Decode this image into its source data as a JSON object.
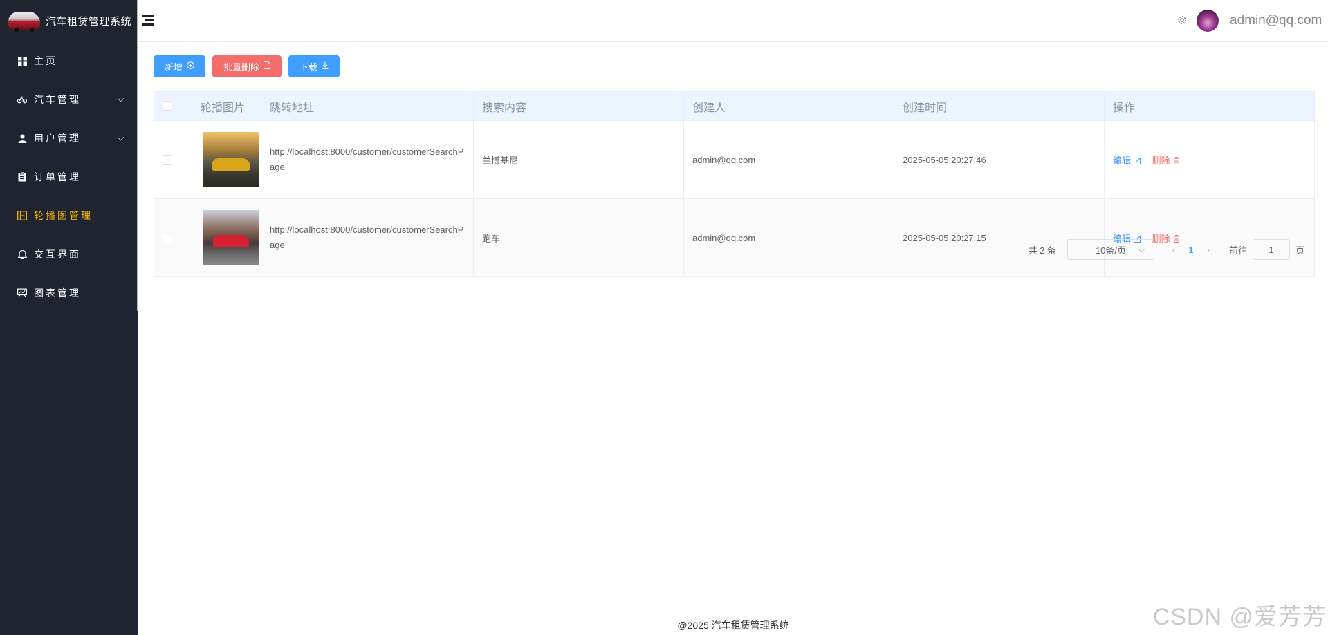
{
  "sidebar": {
    "app_title": "汽车租赁管理系统",
    "items": [
      {
        "label": "主页",
        "icon": "grid-icon"
      },
      {
        "label": "汽车管理",
        "icon": "bicycle-icon",
        "has_arrow": true
      },
      {
        "label": "用户管理",
        "icon": "user-icon",
        "has_arrow": true
      },
      {
        "label": "订单管理",
        "icon": "clipboard-icon"
      },
      {
        "label": "轮播图管理",
        "icon": "carousel-icon",
        "active": true
      },
      {
        "label": "交互界面",
        "icon": "bell-icon"
      },
      {
        "label": "图表管理",
        "icon": "chart-board-icon"
      }
    ]
  },
  "header": {
    "user": "admin@qq.com"
  },
  "toolbar": {
    "add_label": "新增",
    "batch_delete_label": "批量删除",
    "download_label": "下载"
  },
  "table": {
    "columns": [
      "轮播图片",
      "跳转地址",
      "搜索内容",
      "创建人",
      "创建时间",
      "操作"
    ],
    "rows": [
      {
        "url": "http://localhost:8000/customer/customerSearchPage",
        "search": "兰博基尼",
        "creator": "admin@qq.com",
        "created_at": "2025-05-05 20:27:46",
        "edit": "编辑",
        "delete": "删除"
      },
      {
        "url": "http://localhost:8000/customer/customerSearchPage",
        "search": "跑车",
        "creator": "admin@qq.com",
        "created_at": "2025-05-05 20:27:15",
        "edit": "编辑",
        "delete": "删除"
      }
    ]
  },
  "pagination": {
    "total": "共 2 条",
    "page_size": "10条/页",
    "current_page": "1",
    "goto_label": "前往",
    "goto_value": "1",
    "page_suffix": "页"
  },
  "footer": "@2025 汽车租赁管理系统",
  "watermark": "CSDN @爱芳芳",
  "colors": {
    "sidebar_bg": "#202430",
    "active_menu": "#f5b800",
    "primary": "#409eff",
    "danger": "#f56c6c",
    "table_header_bg": "#ecf5ff"
  }
}
